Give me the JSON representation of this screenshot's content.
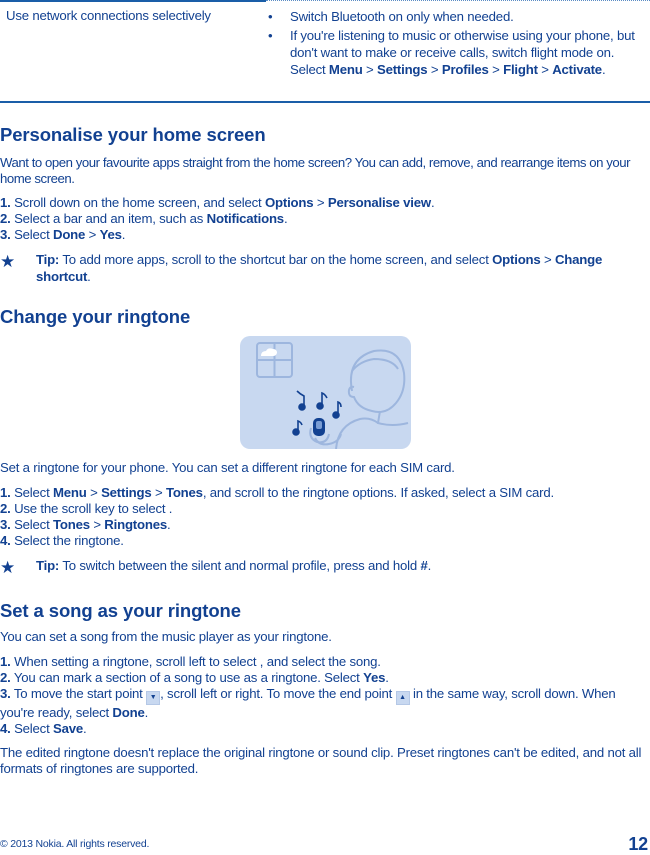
{
  "table": {
    "left_cell": "Use network connections selectively",
    "bullets": [
      {
        "text": "Switch Bluetooth on only when needed."
      },
      {
        "pre": "If you're listening to music or otherwise using your phone, but don't want to make or receive calls, switch flight mode on. Select ",
        "path": [
          "Menu",
          "Settings",
          "Profiles",
          "Flight",
          "Activate"
        ],
        "post": "."
      }
    ],
    "bullet_glyph": "•"
  },
  "section1": {
    "heading": "Personalise your home screen",
    "intro": "Want to open your favourite apps straight from the home screen? You can add, remove, and rearrange items on your home screen.",
    "steps": [
      {
        "num": "1.",
        "pre": "Scroll down on the home screen, and select ",
        "b1": "Options",
        "sep": " > ",
        "b2": "Personalise view",
        "post": "."
      },
      {
        "num": "2.",
        "pre": "Select a bar and an item, such as ",
        "b1": "Notifications",
        "post": "."
      },
      {
        "num": "3.",
        "pre": "Select ",
        "b1": "Done",
        "sep": " > ",
        "b2": "Yes",
        "post": "."
      }
    ],
    "tip": {
      "label": "Tip:",
      "text": " To add more apps, scroll to the shortcut bar on the home screen, and select ",
      "b1": "Options",
      "sep": " > ",
      "b2": "Change shortcut",
      "post": "."
    }
  },
  "section2": {
    "heading": "Change your ringtone",
    "illustration": "person-listening-to-phone-ringtone",
    "intro": "Set a ringtone for your phone. You can set a different ringtone for each SIM card.",
    "steps": [
      {
        "num": "1.",
        "pre": "Select ",
        "b1": "Menu",
        "sep1": " > ",
        "b2": "Settings",
        "sep2": " > ",
        "b3": "Tones",
        "post": ", and scroll to the ringtone options. If asked, select a SIM card."
      },
      {
        "num": "2.",
        "pre": "Use the scroll key to select ."
      },
      {
        "num": "3.",
        "pre": "Select ",
        "b1": "Tones",
        "sep": " > ",
        "b2": "Ringtones",
        "post": "."
      },
      {
        "num": "4.",
        "pre": "Select the ringtone."
      }
    ],
    "tip": {
      "label": "Tip:",
      "text": " To switch between the silent and normal profile, press and hold ",
      "b1": "#",
      "post": "."
    }
  },
  "section3": {
    "heading": "Set a song as your ringtone",
    "intro": "You can set a song from the music player as your ringtone.",
    "steps": [
      {
        "num": "1.",
        "pre": "When setting a ringtone, scroll left to select , and select the song."
      },
      {
        "num": "2.",
        "pre": "You can mark a section of a song to use as a ringtone. Select ",
        "b1": "Yes",
        "post": "."
      },
      {
        "num": "3.",
        "pre": "To move the start point ",
        "mid": ", scroll left or right. To move the end point ",
        "mid2": " in the same way, scroll down. When you're ready, select ",
        "b1": "Done",
        "post": "."
      },
      {
        "num": "4.",
        "pre": "Select ",
        "b1": "Save",
        "post": "."
      }
    ],
    "outro": "The edited ringtone doesn't replace the original ringtone or sound clip. Preset ringtones can't be edited, and not all formats of ringtones are supported."
  },
  "footer": {
    "copyright": "© 2013 Nokia. All rights reserved.",
    "page_number": "12"
  },
  "colors": {
    "text": "#124191",
    "rule": "#1a5ea8",
    "illustration_bg": "#c8d8f0"
  }
}
